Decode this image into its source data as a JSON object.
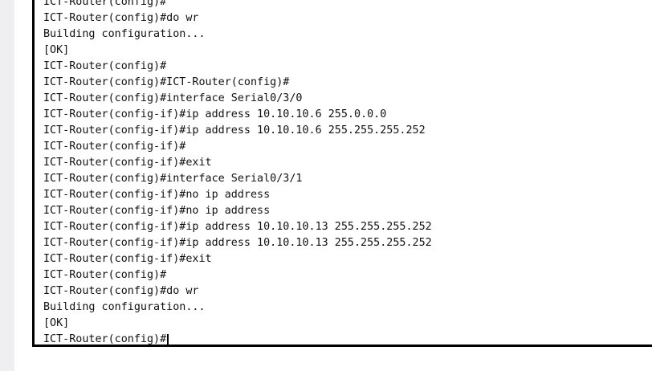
{
  "terminal": {
    "lines": [
      "ICT-Router(config)#",
      "ICT-Router(config)#do wr",
      "Building configuration...",
      "[OK]",
      "ICT-Router(config)#",
      "ICT-Router(config)#ICT-Router(config)#",
      "ICT-Router(config)#interface Serial0/3/0",
      "ICT-Router(config-if)#ip address 10.10.10.6 255.0.0.0",
      "ICT-Router(config-if)#ip address 10.10.10.6 255.255.255.252",
      "ICT-Router(config-if)#",
      "ICT-Router(config-if)#exit",
      "ICT-Router(config)#interface Serial0/3/1",
      "ICT-Router(config-if)#no ip address",
      "ICT-Router(config-if)#no ip address",
      "ICT-Router(config-if)#ip address 10.10.10.13 255.255.255.252",
      "ICT-Router(config-if)#ip address 10.10.10.13 255.255.255.252",
      "ICT-Router(config-if)#exit",
      "ICT-Router(config)#",
      "ICT-Router(config)#do wr",
      "Building configuration...",
      "[OK]"
    ],
    "current_prompt": "ICT-Router(config)#"
  }
}
